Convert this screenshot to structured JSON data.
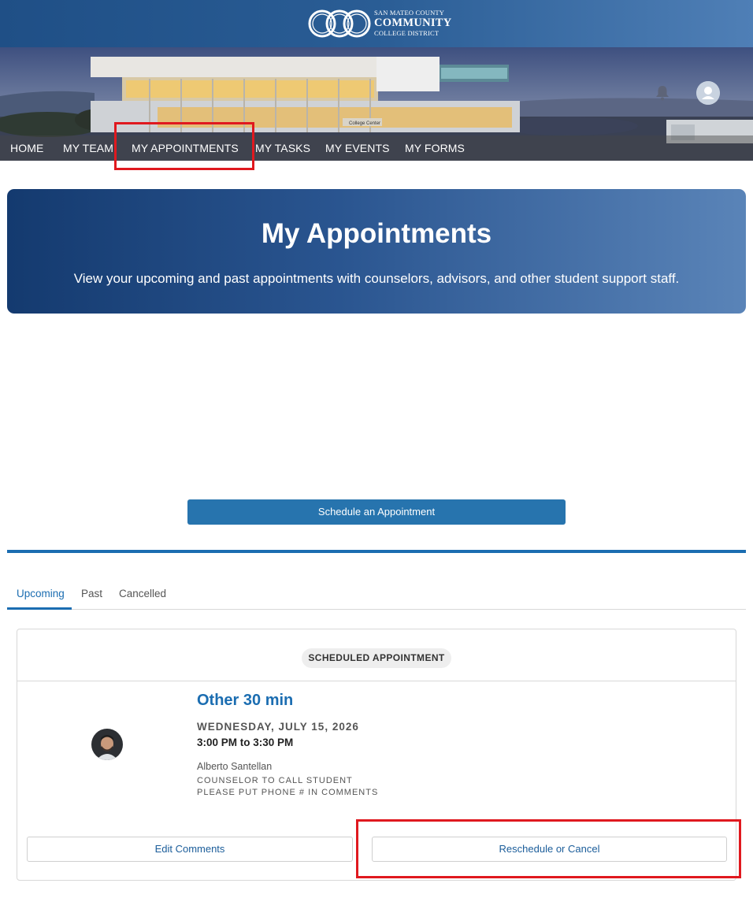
{
  "header": {
    "logo_line1": "SAN MATEO COUNTY",
    "logo_line2": "COMMUNITY",
    "logo_line3": "COLLEGE DISTRICT",
    "photo_sign": "College Center",
    "notifications_icon": "bell-icon",
    "profile_icon": "user-avatar-icon"
  },
  "nav": {
    "items": [
      {
        "label": "HOME"
      },
      {
        "label": "MY TEAM"
      },
      {
        "label": "MY APPOINTMENTS"
      },
      {
        "label": "MY TASKS"
      },
      {
        "label": "MY EVENTS"
      },
      {
        "label": "MY FORMS"
      }
    ]
  },
  "banner": {
    "title": "My Appointments",
    "subtitle": "View your upcoming and past appointments with counselors, advisors, and other student support staff."
  },
  "actions": {
    "schedule_label": "Schedule an Appointment"
  },
  "tabs": [
    {
      "label": "Upcoming",
      "active": true
    },
    {
      "label": "Past",
      "active": false
    },
    {
      "label": "Cancelled",
      "active": false
    }
  ],
  "appointment": {
    "status": "SCHEDULED APPOINTMENT",
    "title": "Other 30 min",
    "date": "WEDNESDAY, JULY 15, 2026",
    "time": "3:00 PM to 3:30 PM",
    "counselor": "Alberto Santellan",
    "note_line1": "COUNSELOR TO CALL STUDENT",
    "note_line2": "PLEASE PUT PHONE # IN COMMENTS",
    "edit_label": "Edit Comments",
    "reschedule_label": "Reschedule or Cancel"
  },
  "colors": {
    "accent": "#1b6db1",
    "button": "#2774ae",
    "highlight": "#e0191f"
  }
}
